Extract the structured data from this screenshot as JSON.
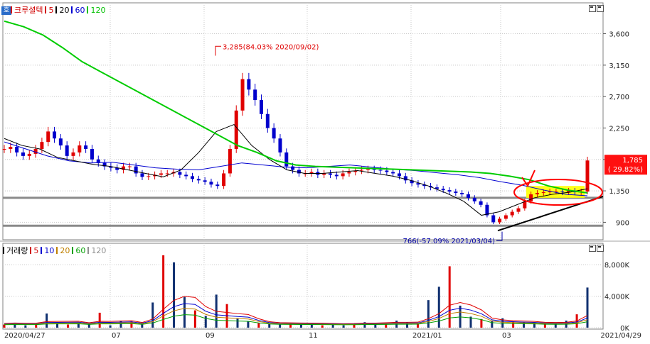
{
  "window": {
    "corner_tag": "호",
    "price_pane": {
      "legend": [
        {
          "label": "크루셜텍",
          "color": "#d00000",
          "kind": "name"
        },
        {
          "label": "5",
          "color": "#d00000",
          "kind": "ma"
        },
        {
          "label": "20",
          "color": "#000000",
          "kind": "ma"
        },
        {
          "label": "60",
          "color": "#0000d0",
          "kind": "ma"
        },
        {
          "label": "120",
          "color": "#00c000",
          "kind": "ma"
        }
      ]
    },
    "volume_pane": {
      "legend": [
        {
          "label": "거래량",
          "color": "#000000",
          "kind": "name"
        },
        {
          "label": "5",
          "color": "#d00000",
          "kind": "ma"
        },
        {
          "label": "10",
          "color": "#0000d0",
          "kind": "ma"
        },
        {
          "label": "20",
          "color": "#c08000",
          "kind": "ma"
        },
        {
          "label": "60",
          "color": "#00a000",
          "kind": "ma"
        },
        {
          "label": "120",
          "color": "#909090",
          "kind": "ma"
        }
      ]
    },
    "colors": {
      "up": "#e00000",
      "down": "#0000cc",
      "ma5": "#e00000",
      "ma20": "#000000",
      "ma60": "#0000d0",
      "ma120": "#00cc00",
      "highlight": "#ffff00",
      "grid": "#c8c8c8"
    }
  },
  "chart_data": [
    {
      "type": "candlestick",
      "title": "크루셜텍",
      "y_ticks": [
        900,
        1350,
        1800,
        2250,
        2700,
        3150,
        3600
      ],
      "y_tick_labels": [
        "900",
        "1,350",
        "1,800",
        "2,250",
        "2,700",
        "3,150",
        "3,600"
      ],
      "ylim": [
        650,
        3900
      ],
      "x_ticks": [
        "2020/04/27",
        "07",
        "09",
        "11",
        "2021/01",
        "03",
        "2021/04/29"
      ],
      "annotations": {
        "high": {
          "label": "3,285(84.03% 2020/09/02)",
          "value": 3285
        },
        "low": {
          "label": "766(-57.09% 2021/03/04)",
          "value": 766
        },
        "last": {
          "price": "1,785",
          "change": "( 29.82%)",
          "value": 1785
        }
      },
      "horizontal_lines": [
        1250,
        850
      ],
      "series_close": [
        1950,
        1980,
        1900,
        1850,
        1880,
        1950,
        2050,
        2200,
        2100,
        2000,
        1850,
        1900,
        2000,
        1950,
        1800,
        1750,
        1700,
        1680,
        1650,
        1700,
        1700,
        1600,
        1550,
        1560,
        1580,
        1600,
        1600,
        1620,
        1580,
        1560,
        1520,
        1500,
        1480,
        1440,
        1420,
        1600,
        1950,
        2500,
        2950,
        2800,
        2650,
        2450,
        2250,
        2100,
        1900,
        1700,
        1650,
        1600,
        1600,
        1620,
        1580,
        1600,
        1580,
        1560,
        1600,
        1620,
        1640,
        1650,
        1660,
        1650,
        1640,
        1620,
        1600,
        1560,
        1500,
        1460,
        1440,
        1420,
        1400,
        1380,
        1360,
        1340,
        1320,
        1300,
        1250,
        1200,
        1150,
        1000,
        900,
        950,
        1000,
        1050,
        1100,
        1200,
        1300,
        1320,
        1330,
        1340,
        1340,
        1330,
        1350,
        1330,
        1340,
        1785
      ],
      "ma120": [
        3780,
        3700,
        3580,
        3400,
        3200,
        3050,
        2900,
        2750,
        2600,
        2450,
        2300,
        2150,
        2000,
        1900,
        1780,
        1720,
        1700,
        1690,
        1680,
        1670,
        1660,
        1650,
        1640,
        1630,
        1620,
        1600,
        1560,
        1510,
        1420,
        1360,
        1320
      ],
      "ma60": [
        2050,
        1950,
        1850,
        1780,
        1750,
        1760,
        1720,
        1680,
        1660,
        1650,
        1700,
        1750,
        1720,
        1690,
        1680,
        1700,
        1720,
        1690,
        1660,
        1640,
        1610,
        1580,
        1540,
        1480,
        1430,
        1360,
        1300,
        1280
      ],
      "ma20": [
        2100,
        2000,
        1950,
        1830,
        1780,
        1730,
        1700,
        1650,
        1600,
        1550,
        1650,
        1900,
        2200,
        2300,
        2000,
        1800,
        1650,
        1600,
        1600,
        1620,
        1640,
        1600,
        1560,
        1500,
        1420,
        1320,
        1200,
        1000,
        1050,
        1150,
        1250,
        1300,
        1330,
        1380
      ]
    },
    {
      "type": "bar",
      "title": "거래량",
      "y_ticks": [
        0,
        4000,
        8000
      ],
      "y_tick_labels": [
        "0K",
        "4,000K",
        "8,000K"
      ],
      "ylim": [
        0,
        10000
      ],
      "values": [
        400,
        600,
        300,
        500,
        1800,
        700,
        400,
        600,
        500,
        1900,
        300,
        900,
        800,
        400,
        3200,
        9200,
        8300,
        3900,
        2200,
        1500,
        4200,
        3000,
        1200,
        800,
        600,
        500,
        400,
        600,
        500,
        400,
        300,
        400,
        300,
        500,
        700,
        400,
        600,
        900,
        700,
        500,
        3500,
        5200,
        7800,
        2800,
        1400,
        1100,
        900,
        1200,
        800,
        700,
        600,
        500,
        600,
        900,
        1700,
        5100
      ]
    }
  ]
}
